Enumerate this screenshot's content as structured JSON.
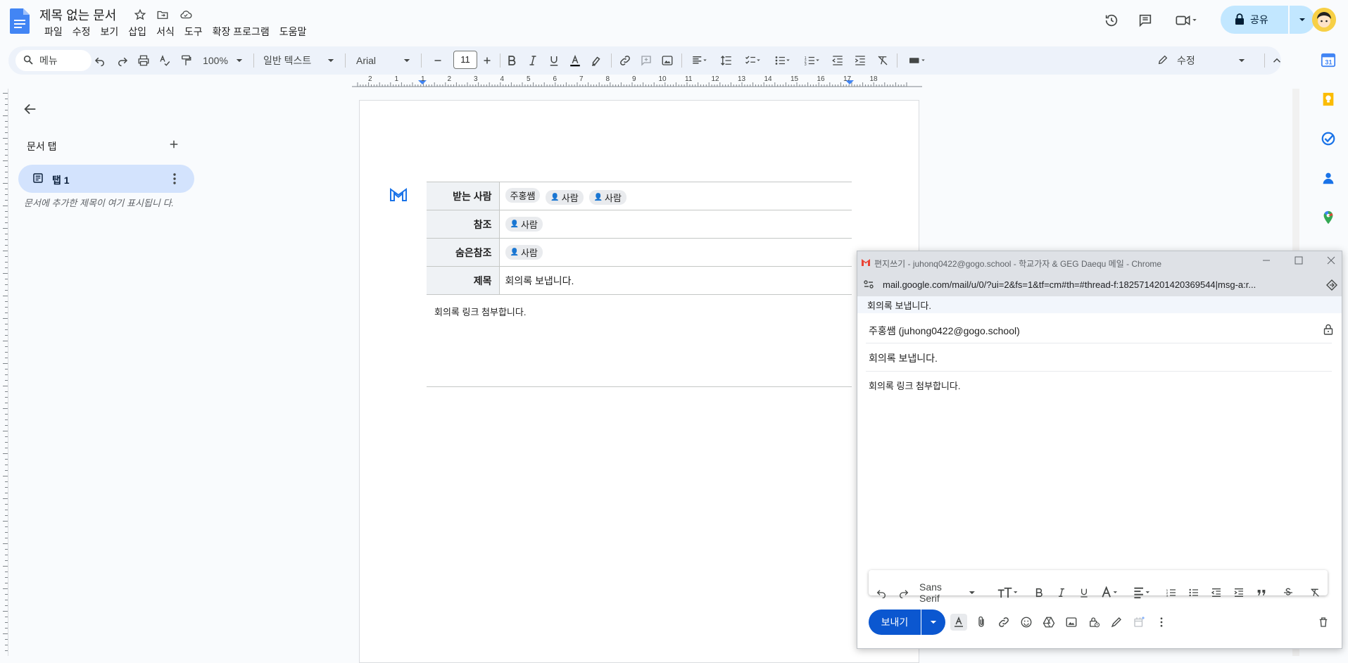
{
  "header": {
    "title": "제목 없는 문서",
    "menus": [
      "파일",
      "수정",
      "보기",
      "삽입",
      "서식",
      "도구",
      "확장 프로그램",
      "도움말"
    ],
    "share_label": "공유"
  },
  "toolbar": {
    "search_label": "메뉴",
    "zoom": "100%",
    "style": "일반 텍스트",
    "font": "Arial",
    "font_size": "11",
    "mode": "수정"
  },
  "ruler": {
    "ticks": [
      "2",
      "1",
      "1",
      "2",
      "3",
      "4",
      "5",
      "6",
      "7",
      "8",
      "9",
      "10",
      "11",
      "12",
      "13",
      "14",
      "15",
      "16",
      "17",
      "18"
    ]
  },
  "outline": {
    "title": "문서 탭",
    "tab_label": "탭 1",
    "hint": "문서에 추가한 제목이 여기 표시됩니 다."
  },
  "email_draft": {
    "to_label": "받는 사람",
    "to_chips": [
      "주홍쌤",
      "사람",
      "사람"
    ],
    "cc_label": "참조",
    "cc_chips": [
      "사람"
    ],
    "bcc_label": "숨은참조",
    "bcc_chips": [
      "사람"
    ],
    "subject_label": "제목",
    "subject": "회의록 보냅니다.",
    "body": "회의록 링크 첨부합니다."
  },
  "popup": {
    "window_title": "편지쓰기 - juhonq0422@gogo.school - 학교가자 & GEG Daequ 메일 - Chrome",
    "url": "mail.google.com/mail/u/0/?ui=2&fs=1&tf=cm#th=#thread-f:1825714201420369544|msg-a:r...",
    "subject_header": "회의록 보냅니다.",
    "recipient": "주홍쌤 (juhong0422@gogo.school)",
    "subject": "회의록 보냅니다.",
    "body": "회의록 링크 첨부합니다.",
    "font_name": "Sans Serif",
    "send_label": "보내기"
  },
  "colors": {
    "accent": "#0b57d0",
    "share_bg": "#c2e7ff",
    "tab_active": "#d3e3fd",
    "toolbar_bg": "#edf2fa"
  }
}
